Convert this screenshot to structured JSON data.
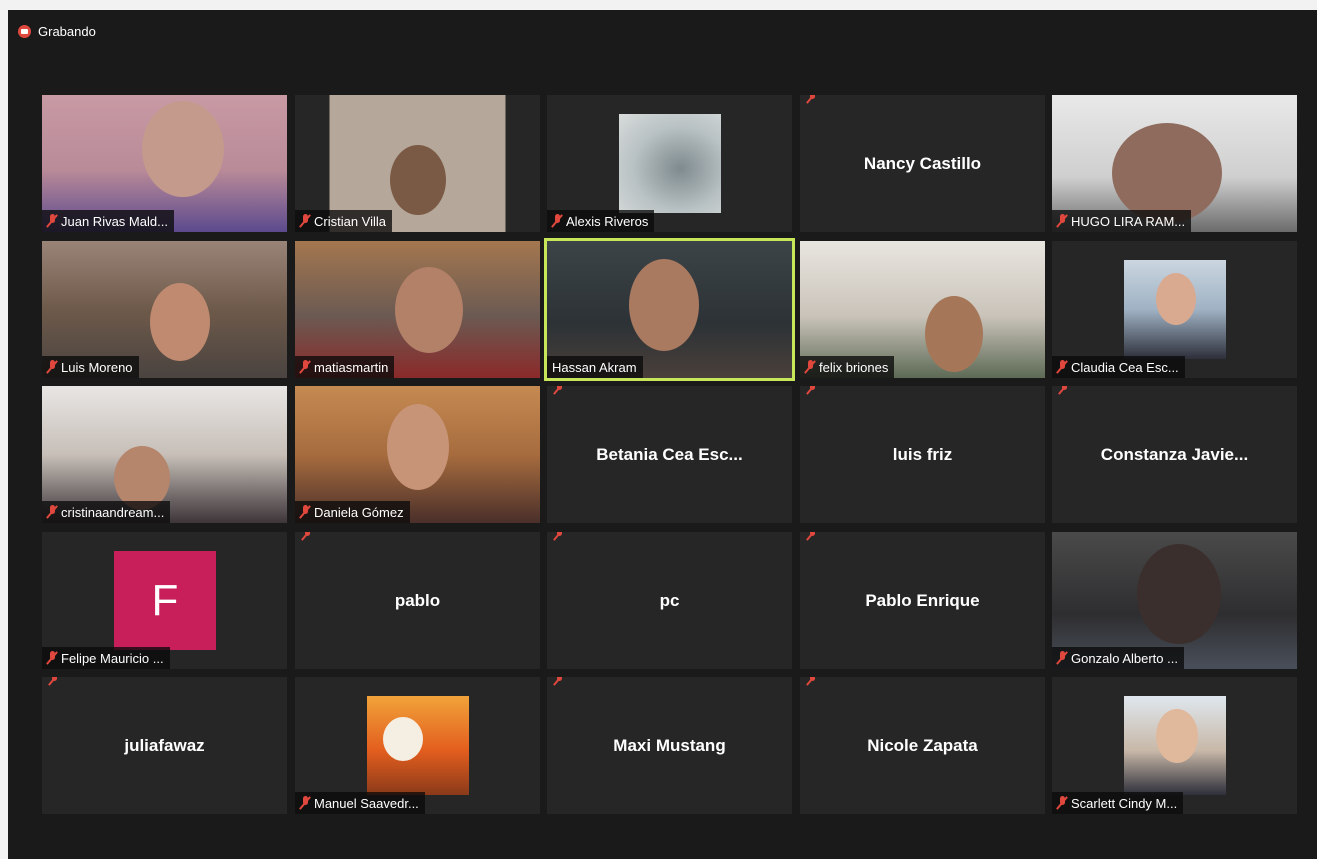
{
  "recording": {
    "label": "Grabando",
    "color": "#e0483e"
  },
  "active_speaker_color": "#c8e65a",
  "participants": [
    {
      "name": "Juan Rivas Mald...",
      "kind": "video"
    },
    {
      "name": "Cristian Villa",
      "kind": "video"
    },
    {
      "name": "Alexis Riveros",
      "kind": "photo"
    },
    {
      "name": "Nancy Castillo",
      "kind": "name"
    },
    {
      "name": "HUGO LIRA RAM...",
      "kind": "video"
    },
    {
      "name": "Luis Moreno",
      "kind": "video"
    },
    {
      "name": "matiasmartin",
      "kind": "video"
    },
    {
      "name": "Hassan Akram",
      "kind": "video",
      "active": true
    },
    {
      "name": "felix briones",
      "kind": "video"
    },
    {
      "name": "Claudia Cea Esc...",
      "kind": "photo"
    },
    {
      "name": "cristinaandream...",
      "kind": "video"
    },
    {
      "name": "Daniela Gómez",
      "kind": "video"
    },
    {
      "name": "Betania Cea Esc...",
      "kind": "name"
    },
    {
      "name": "luis friz",
      "kind": "name"
    },
    {
      "name": "Constanza Javie...",
      "kind": "name"
    },
    {
      "name": "Felipe Mauricio ...",
      "kind": "initial",
      "initial": "F",
      "avatar_color": "#c81e5a"
    },
    {
      "name": "pablo",
      "kind": "name"
    },
    {
      "name": "pc",
      "kind": "name"
    },
    {
      "name": "Pablo Enrique",
      "kind": "name"
    },
    {
      "name": "Gonzalo Alberto ...",
      "kind": "video"
    },
    {
      "name": "juliafawaz",
      "kind": "name"
    },
    {
      "name": "Manuel Saavedr...",
      "kind": "photo"
    },
    {
      "name": "Maxi Mustang",
      "kind": "name"
    },
    {
      "name": "Nicole Zapata",
      "kind": "name"
    },
    {
      "name": "Scarlett Cindy M...",
      "kind": "photo"
    }
  ]
}
